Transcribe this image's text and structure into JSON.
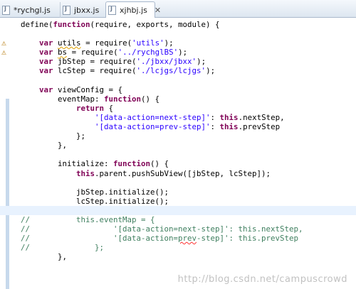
{
  "tabs": [
    {
      "label": "*rychgl.js",
      "active": false,
      "closable": false
    },
    {
      "label": "jbxx.js",
      "active": false,
      "closable": false
    },
    {
      "label": "xjhbj.js",
      "active": true,
      "closable": true
    }
  ],
  "tab_close_glyph": "✕",
  "code_lines": [
    {
      "html": "define(<span class='kw'>function</span>(require, exports, module) {"
    },
    {
      "html": ""
    },
    {
      "html": "    <span class='kw'>var</span> <span class='warn-underline'>utils</span> = require(<span class='str'>'utils'</span>);",
      "warning": true
    },
    {
      "html": "    <span class='kw'>var</span> <span class='warn-underline'>bs</span> = require(<span class='str'>'../rychglBS'</span>);",
      "warning": true
    },
    {
      "html": "    <span class='kw'>var</span> jbStep = require(<span class='str'>'./jbxx/jbxx'</span>);"
    },
    {
      "html": "    <span class='kw'>var</span> lcStep = require(<span class='str'>'./lcjgs/lcjgs'</span>);"
    },
    {
      "html": ""
    },
    {
      "html": "    <span class='kw'>var</span> viewConfig = {"
    },
    {
      "html": "        eventMap: <span class='kw'>function</span>() {"
    },
    {
      "html": "            <span class='kw'>return</span> {"
    },
    {
      "html": "                <span class='str'>'[data-action=next-step]'</span>: <span class='kw'>this</span>.nextStep,"
    },
    {
      "html": "                <span class='str'>'[data-action=prev-step]'</span>: <span class='kw'>this</span>.prevStep"
    },
    {
      "html": "            };"
    },
    {
      "html": "        },"
    },
    {
      "html": ""
    },
    {
      "html": "        initialize: <span class='kw'>function</span>() {"
    },
    {
      "html": "            <span class='kw'>this</span>.parent.pushSubView([jbStep, lcStep]);"
    },
    {
      "html": ""
    },
    {
      "html": "            jbStep.initialize();"
    },
    {
      "html": "            lcStep.initialize();"
    },
    {
      "html": "",
      "current": true
    },
    {
      "html": "<span class='cm'>//          this.eventMap = {</span>"
    },
    {
      "html": "<span class='cm'>//                  '[data-action=next-step]': this.nextStep,</span>"
    },
    {
      "html": "<span class='cm'>//                  '[data-action=<span class='err-underline'>prev</span>-step]': this.prevStep</span>"
    },
    {
      "html": "<span class='cm'>//              };</span>"
    },
    {
      "html": "        },"
    }
  ],
  "watermark": "http://blog.csdn.net/campuscrowd"
}
